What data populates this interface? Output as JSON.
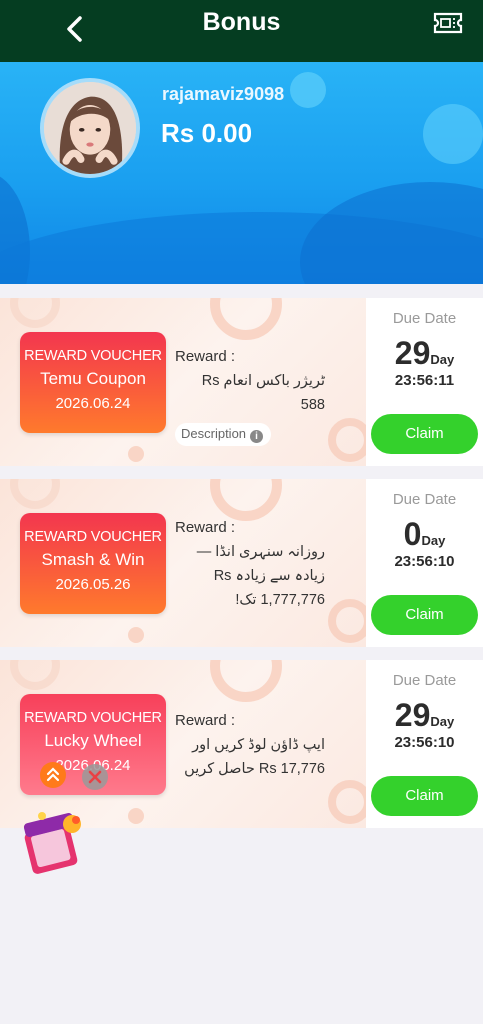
{
  "header": {
    "title": "Bonus"
  },
  "profile": {
    "username": "rajamaviz9098",
    "balance": "Rs 0.00"
  },
  "labels": {
    "reward": "Reward :",
    "due_date": "Due Date",
    "day_unit": "Day",
    "claim": "Claim",
    "description": "Description"
  },
  "vouchers": [
    {
      "title": "REWARD VOUCHER",
      "name": "Temu Coupon",
      "date": "2026.06.24",
      "reward_text": "ٹریژر باکس انعام Rs 588",
      "days": "29",
      "time": "23:56:11"
    },
    {
      "title": "REWARD VOUCHER",
      "name": "Smash & Win",
      "date": "2026.05.26",
      "reward_text": "روزانہ سنہری انڈا — زیادہ سے زیادہ Rs 1,777,776 تک!",
      "days": "0",
      "time": "23:56:10"
    },
    {
      "title": "REWARD VOUCHER",
      "name": "Lucky Wheel",
      "date": "2026.06.24",
      "reward_text": "ایپ ڈاؤن لوڈ کریں اور Rs 17,776 حاصل کریں",
      "days": "29",
      "time": "23:56:10"
    }
  ],
  "colors": {
    "header_bg": "#053d21",
    "banner_blue": "#1a9ff0",
    "claim_green": "#34d12c",
    "voucher_red": "#f3364f"
  },
  "icons": [
    "back-arrow-icon",
    "ticket-icon",
    "info-icon",
    "scroll-up-icon",
    "close-icon",
    "gift-box-icon"
  ]
}
